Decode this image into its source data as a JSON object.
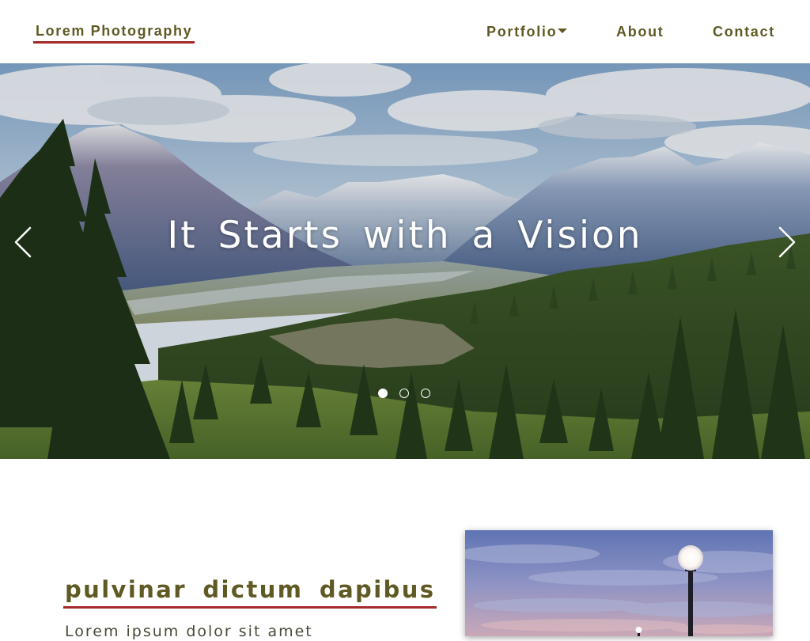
{
  "header": {
    "logo": "Lorem Photography",
    "nav": {
      "portfolio": "Portfolio",
      "about": "About",
      "contact": "Contact"
    }
  },
  "hero": {
    "title": "It Starts with a Vision",
    "slide_count": 3,
    "active_slide": 1,
    "prev_icon": "chevron-left-icon",
    "next_icon": "chevron-right-icon"
  },
  "section": {
    "heading": "pulvinar dictum dapibus",
    "text": "Lorem ipsum dolor sit amet"
  },
  "colors": {
    "accent_text": "#5f5a24",
    "underline": "#a32b2b"
  }
}
